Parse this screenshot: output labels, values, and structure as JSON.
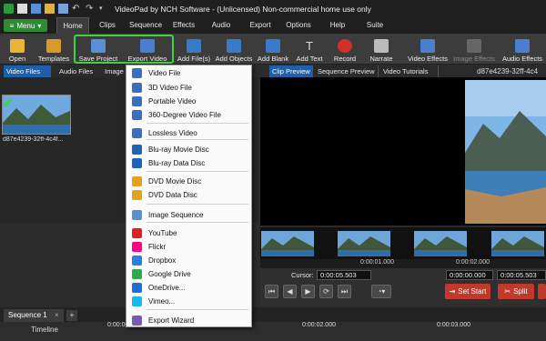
{
  "window": {
    "title": "VideoPad by NCH Software - (Unlicensed) Non-commercial home use only"
  },
  "menu_button": {
    "label": "Menu"
  },
  "tabs": [
    "Home",
    "Clips",
    "Sequence",
    "Effects",
    "Audio",
    "Export",
    "Options",
    "Help",
    "Suite"
  ],
  "toolbar": {
    "open": "Open",
    "templates": "Templates",
    "save_project": "Save Project",
    "export_video": "Export Video",
    "add_files": "Add File(s)",
    "add_objects": "Add Objects",
    "add_blank": "Add Blank",
    "add_text": "Add Text",
    "record": "Record",
    "narrate": "Narrate",
    "video_effects": "Video Effects",
    "image_effects": "Image Effects",
    "audio_effects": "Audio Effects"
  },
  "left_tabs": [
    "Video Files",
    "Audio Files",
    "Image"
  ],
  "clip_thumb_label": "d87e4239-32ff-4c4f...",
  "export_menu": {
    "items": [
      {
        "label": "Video File",
        "icon": "film-icon",
        "color": "#3a6fbf"
      },
      {
        "label": "3D Video File",
        "icon": "3d-film-icon",
        "color": "#3a6fbf"
      },
      {
        "label": "Portable Video",
        "icon": "phone-icon",
        "color": "#3a6fbf"
      },
      {
        "label": "360-Degree Video File",
        "icon": "360-icon",
        "color": "#3a6fbf"
      },
      {
        "label": "Lossless Video",
        "icon": "lossless-icon",
        "color": "#3a6fbf"
      },
      {
        "label": "Blu-ray Movie Disc",
        "icon": "bluray-icon",
        "color": "#1e63b5"
      },
      {
        "label": "Blu-ray Data Disc",
        "icon": "bluray-data-icon",
        "color": "#1e63b5"
      },
      {
        "label": "DVD Movie Disc",
        "icon": "dvd-icon",
        "color": "#e3a21a"
      },
      {
        "label": "DVD Data Disc",
        "icon": "dvd-data-icon",
        "color": "#e3a21a"
      },
      {
        "label": "Image Sequence",
        "icon": "image-sequence-icon",
        "color": "#5a8fcf"
      },
      {
        "label": "YouTube",
        "icon": "youtube-icon",
        "color": "#e02020"
      },
      {
        "label": "Flickr",
        "icon": "flickr-icon",
        "color": "#ff0084"
      },
      {
        "label": "Dropbox",
        "icon": "dropbox-icon",
        "color": "#2a7de1"
      },
      {
        "label": "Google Drive",
        "icon": "google-drive-icon",
        "color": "#2fa84f"
      },
      {
        "label": "OneDrive...",
        "icon": "onedrive-icon",
        "color": "#1f6fd1"
      },
      {
        "label": "Vimeo...",
        "icon": "vimeo-icon",
        "color": "#1ab7ea"
      },
      {
        "label": "Export Wizard",
        "icon": "wizard-icon",
        "color": "#7a5ab8"
      }
    ]
  },
  "right_tabs": [
    "Clip Preview",
    "Sequence Preview",
    "Video Tutorials"
  ],
  "clip_id": "d87e4239-32ff-4c4",
  "ruler": {
    "t1": "0:00:01.000",
    "t2": "0:00:02.000"
  },
  "controls": {
    "cursor_label": "Cursor:",
    "cursor_value": "0:00:05.503",
    "range_start": "0:00:00.000",
    "range_end": "0:00:05.503",
    "set_start": "Set Start",
    "split": "Split"
  },
  "sequence": {
    "tab_label": "Sequence 1",
    "close": "×",
    "add": "+",
    "timeline_label": "Timeline",
    "t0": "0:00:00.000",
    "t1": "0:00:02.000",
    "t2": "0:00:03.000"
  },
  "colors": {
    "accent_green": "#2e8b34",
    "highlight": "#3bd63b",
    "tab_blue": "#1f5fa8",
    "record_red": "#c0392b"
  }
}
